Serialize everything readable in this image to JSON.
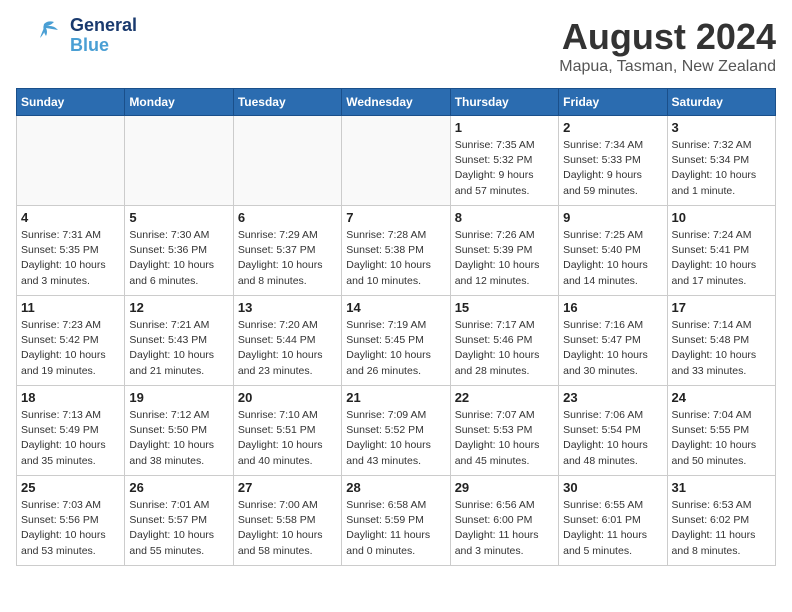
{
  "header": {
    "logo_general": "General",
    "logo_blue": "Blue",
    "month_title": "August 2024",
    "location": "Mapua, Tasman, New Zealand"
  },
  "days_of_week": [
    "Sunday",
    "Monday",
    "Tuesday",
    "Wednesday",
    "Thursday",
    "Friday",
    "Saturday"
  ],
  "weeks": [
    [
      {
        "day": "",
        "info": ""
      },
      {
        "day": "",
        "info": ""
      },
      {
        "day": "",
        "info": ""
      },
      {
        "day": "",
        "info": ""
      },
      {
        "day": "1",
        "info": "Sunrise: 7:35 AM\nSunset: 5:32 PM\nDaylight: 9 hours\nand 57 minutes."
      },
      {
        "day": "2",
        "info": "Sunrise: 7:34 AM\nSunset: 5:33 PM\nDaylight: 9 hours\nand 59 minutes."
      },
      {
        "day": "3",
        "info": "Sunrise: 7:32 AM\nSunset: 5:34 PM\nDaylight: 10 hours\nand 1 minute."
      }
    ],
    [
      {
        "day": "4",
        "info": "Sunrise: 7:31 AM\nSunset: 5:35 PM\nDaylight: 10 hours\nand 3 minutes."
      },
      {
        "day": "5",
        "info": "Sunrise: 7:30 AM\nSunset: 5:36 PM\nDaylight: 10 hours\nand 6 minutes."
      },
      {
        "day": "6",
        "info": "Sunrise: 7:29 AM\nSunset: 5:37 PM\nDaylight: 10 hours\nand 8 minutes."
      },
      {
        "day": "7",
        "info": "Sunrise: 7:28 AM\nSunset: 5:38 PM\nDaylight: 10 hours\nand 10 minutes."
      },
      {
        "day": "8",
        "info": "Sunrise: 7:26 AM\nSunset: 5:39 PM\nDaylight: 10 hours\nand 12 minutes."
      },
      {
        "day": "9",
        "info": "Sunrise: 7:25 AM\nSunset: 5:40 PM\nDaylight: 10 hours\nand 14 minutes."
      },
      {
        "day": "10",
        "info": "Sunrise: 7:24 AM\nSunset: 5:41 PM\nDaylight: 10 hours\nand 17 minutes."
      }
    ],
    [
      {
        "day": "11",
        "info": "Sunrise: 7:23 AM\nSunset: 5:42 PM\nDaylight: 10 hours\nand 19 minutes."
      },
      {
        "day": "12",
        "info": "Sunrise: 7:21 AM\nSunset: 5:43 PM\nDaylight: 10 hours\nand 21 minutes."
      },
      {
        "day": "13",
        "info": "Sunrise: 7:20 AM\nSunset: 5:44 PM\nDaylight: 10 hours\nand 23 minutes."
      },
      {
        "day": "14",
        "info": "Sunrise: 7:19 AM\nSunset: 5:45 PM\nDaylight: 10 hours\nand 26 minutes."
      },
      {
        "day": "15",
        "info": "Sunrise: 7:17 AM\nSunset: 5:46 PM\nDaylight: 10 hours\nand 28 minutes."
      },
      {
        "day": "16",
        "info": "Sunrise: 7:16 AM\nSunset: 5:47 PM\nDaylight: 10 hours\nand 30 minutes."
      },
      {
        "day": "17",
        "info": "Sunrise: 7:14 AM\nSunset: 5:48 PM\nDaylight: 10 hours\nand 33 minutes."
      }
    ],
    [
      {
        "day": "18",
        "info": "Sunrise: 7:13 AM\nSunset: 5:49 PM\nDaylight: 10 hours\nand 35 minutes."
      },
      {
        "day": "19",
        "info": "Sunrise: 7:12 AM\nSunset: 5:50 PM\nDaylight: 10 hours\nand 38 minutes."
      },
      {
        "day": "20",
        "info": "Sunrise: 7:10 AM\nSunset: 5:51 PM\nDaylight: 10 hours\nand 40 minutes."
      },
      {
        "day": "21",
        "info": "Sunrise: 7:09 AM\nSunset: 5:52 PM\nDaylight: 10 hours\nand 43 minutes."
      },
      {
        "day": "22",
        "info": "Sunrise: 7:07 AM\nSunset: 5:53 PM\nDaylight: 10 hours\nand 45 minutes."
      },
      {
        "day": "23",
        "info": "Sunrise: 7:06 AM\nSunset: 5:54 PM\nDaylight: 10 hours\nand 48 minutes."
      },
      {
        "day": "24",
        "info": "Sunrise: 7:04 AM\nSunset: 5:55 PM\nDaylight: 10 hours\nand 50 minutes."
      }
    ],
    [
      {
        "day": "25",
        "info": "Sunrise: 7:03 AM\nSunset: 5:56 PM\nDaylight: 10 hours\nand 53 minutes."
      },
      {
        "day": "26",
        "info": "Sunrise: 7:01 AM\nSunset: 5:57 PM\nDaylight: 10 hours\nand 55 minutes."
      },
      {
        "day": "27",
        "info": "Sunrise: 7:00 AM\nSunset: 5:58 PM\nDaylight: 10 hours\nand 58 minutes."
      },
      {
        "day": "28",
        "info": "Sunrise: 6:58 AM\nSunset: 5:59 PM\nDaylight: 11 hours\nand 0 minutes."
      },
      {
        "day": "29",
        "info": "Sunrise: 6:56 AM\nSunset: 6:00 PM\nDaylight: 11 hours\nand 3 minutes."
      },
      {
        "day": "30",
        "info": "Sunrise: 6:55 AM\nSunset: 6:01 PM\nDaylight: 11 hours\nand 5 minutes."
      },
      {
        "day": "31",
        "info": "Sunrise: 6:53 AM\nSunset: 6:02 PM\nDaylight: 11 hours\nand 8 minutes."
      }
    ]
  ]
}
